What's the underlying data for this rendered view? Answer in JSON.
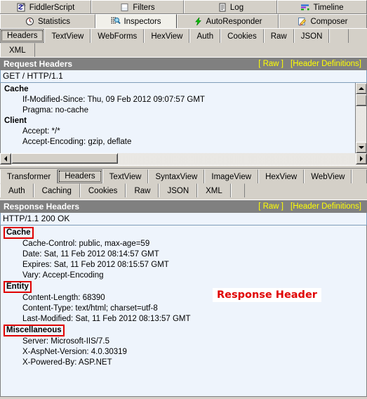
{
  "top_tabs": {
    "row1": [
      {
        "label": "FiddlerScript",
        "icon": "script-icon",
        "selected": false
      },
      {
        "label": "Filters",
        "icon": "filters-icon",
        "selected": false
      },
      {
        "label": "Log",
        "icon": "log-icon",
        "selected": false
      },
      {
        "label": "Timeline",
        "icon": "timeline-icon",
        "selected": false
      }
    ],
    "row2": [
      {
        "label": "Statistics",
        "icon": "clock-icon",
        "selected": false
      },
      {
        "label": "Inspectors",
        "icon": "inspectors-icon",
        "selected": true
      },
      {
        "label": "AutoResponder",
        "icon": "lightning-icon",
        "selected": false
      },
      {
        "label": "Composer",
        "icon": "pencil-icon",
        "selected": false
      }
    ]
  },
  "request_tabs": {
    "row1": [
      {
        "label": "Headers",
        "selected": true
      },
      {
        "label": "TextView",
        "selected": false
      },
      {
        "label": "WebForms",
        "selected": false
      },
      {
        "label": "HexView",
        "selected": false
      },
      {
        "label": "Auth",
        "selected": false
      },
      {
        "label": "Cookies",
        "selected": false
      },
      {
        "label": "Raw",
        "selected": false
      },
      {
        "label": "JSON",
        "selected": false
      }
    ],
    "row2": [
      {
        "label": "XML",
        "selected": false
      }
    ]
  },
  "request_panel": {
    "title": "Request Headers",
    "raw_link": "[ Raw ]",
    "defs_link": "[Header Definitions]",
    "request_line": "GET / HTTP/1.1",
    "groups": [
      {
        "name": "Cache",
        "boxed": false,
        "headers": [
          "If-Modified-Since: Thu, 09 Feb 2012 09:07:57 GMT",
          "Pragma: no-cache"
        ]
      },
      {
        "name": "Client",
        "boxed": false,
        "headers": [
          "Accept: */*",
          "Accept-Encoding: gzip, deflate"
        ]
      }
    ]
  },
  "response_tabs": {
    "row1": [
      {
        "label": "Transformer",
        "selected": false
      },
      {
        "label": "Headers",
        "selected": true
      },
      {
        "label": "TextView",
        "selected": false
      },
      {
        "label": "SyntaxView",
        "selected": false
      },
      {
        "label": "ImageView",
        "selected": false
      },
      {
        "label": "HexView",
        "selected": false
      },
      {
        "label": "WebView",
        "selected": false
      }
    ],
    "row2": [
      {
        "label": "Auth",
        "selected": false
      },
      {
        "label": "Caching",
        "selected": false
      },
      {
        "label": "Cookies",
        "selected": false
      },
      {
        "label": "Raw",
        "selected": false
      },
      {
        "label": "JSON",
        "selected": false
      },
      {
        "label": "XML",
        "selected": false
      }
    ]
  },
  "response_panel": {
    "title": "Response Headers",
    "raw_link": "[ Raw ]",
    "defs_link": "[Header Definitions]",
    "status_line": "HTTP/1.1 200 OK",
    "groups": [
      {
        "name": "Cache",
        "boxed": true,
        "headers": [
          "Cache-Control: public, max-age=59",
          "Date: Sat, 11 Feb 2012 08:14:57 GMT",
          "Expires: Sat, 11 Feb 2012 08:15:57 GMT",
          "Vary: Accept-Encoding"
        ]
      },
      {
        "name": "Entity",
        "boxed": true,
        "headers": [
          "Content-Length: 68390",
          "Content-Type: text/html; charset=utf-8",
          "Last-Modified: Sat, 11 Feb 2012 08:13:57 GMT"
        ]
      },
      {
        "name": "Miscellaneous",
        "boxed": true,
        "headers": [
          "Server: Microsoft-IIS/7.5",
          "X-AspNet-Version: 4.0.30319",
          "X-Powered-By: ASP.NET"
        ]
      }
    ]
  },
  "annotation": {
    "text": "Response Header"
  },
  "colors": {
    "panel_bar_bg": "#808080",
    "panel_bar_link": "#ffff00",
    "body_bg": "#eef4fc",
    "chrome_bg": "#d4d0c8",
    "annotation_red": "#e00000"
  }
}
